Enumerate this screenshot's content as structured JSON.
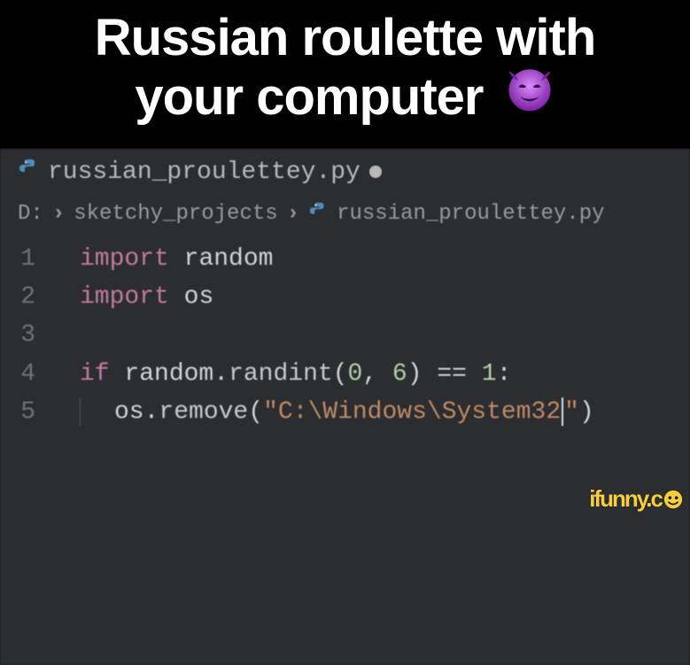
{
  "caption": {
    "line1": "Russian roulette with",
    "line2": "your computer",
    "emoji_name": "smiling-devil"
  },
  "tab": {
    "filename": "russian_proulettey.py",
    "dirty": true
  },
  "breadcrumbs": {
    "drive": "D:",
    "folder": "sketchy_projects",
    "file": "russian_proulettey.py"
  },
  "code": {
    "lines": [
      {
        "n": "1",
        "tokens": [
          {
            "t": "import",
            "c": "kw"
          },
          {
            "t": " ",
            "c": "sp"
          },
          {
            "t": "random",
            "c": "id"
          }
        ]
      },
      {
        "n": "2",
        "tokens": [
          {
            "t": "import",
            "c": "kw"
          },
          {
            "t": " ",
            "c": "sp"
          },
          {
            "t": "os",
            "c": "id"
          }
        ]
      },
      {
        "n": "3",
        "tokens": []
      },
      {
        "n": "4",
        "tokens": [
          {
            "t": "if",
            "c": "kw"
          },
          {
            "t": " ",
            "c": "sp"
          },
          {
            "t": "random",
            "c": "id"
          },
          {
            "t": ".",
            "c": "op"
          },
          {
            "t": "randint",
            "c": "fn"
          },
          {
            "t": "(",
            "c": "pn"
          },
          {
            "t": "0",
            "c": "num"
          },
          {
            "t": ", ",
            "c": "pn"
          },
          {
            "t": "6",
            "c": "num"
          },
          {
            "t": ")",
            "c": "pn"
          },
          {
            "t": " ",
            "c": "sp"
          },
          {
            "t": "==",
            "c": "op"
          },
          {
            "t": " ",
            "c": "sp"
          },
          {
            "t": "1",
            "c": "num"
          },
          {
            "t": ":",
            "c": "pn"
          }
        ]
      },
      {
        "n": "5",
        "tokens": [
          {
            "t": "GUIDE",
            "c": "guide"
          },
          {
            "t": "os",
            "c": "id"
          },
          {
            "t": ".",
            "c": "op"
          },
          {
            "t": "remove",
            "c": "fn"
          },
          {
            "t": "(",
            "c": "pn"
          },
          {
            "t": "\"C:\\Windows\\System32",
            "c": "str"
          },
          {
            "t": "CURSOR",
            "c": "cursor"
          },
          {
            "t": "\"",
            "c": "str"
          },
          {
            "t": ")",
            "c": "pn"
          }
        ]
      }
    ]
  },
  "watermark": {
    "text": "ifunny.c"
  }
}
